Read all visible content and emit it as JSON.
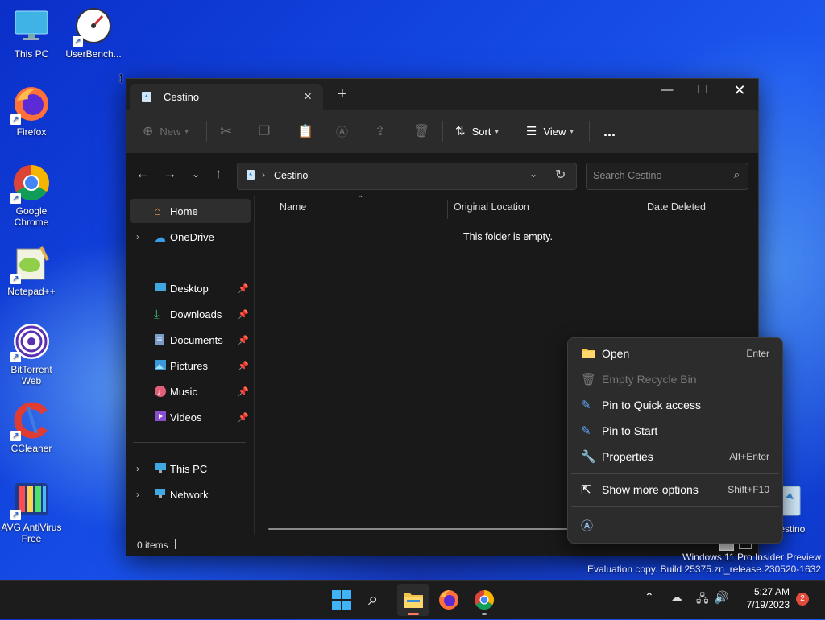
{
  "desktop": {
    "icons": [
      {
        "label": "This PC"
      },
      {
        "label": "UserBench..."
      },
      {
        "label": "Firefox"
      },
      {
        "label": "Google Chrome"
      },
      {
        "label": "Notepad++"
      },
      {
        "label": "BitTorrent Web"
      },
      {
        "label": "CCleaner"
      },
      {
        "label": "AVG AntiVirus Free"
      },
      {
        "label": "Cestino"
      }
    ]
  },
  "explorer": {
    "tab_title": "Cestino",
    "toolbar": {
      "new_label": "New",
      "sort_label": "Sort",
      "view_label": "View",
      "more_label": "..."
    },
    "address": {
      "path": "Cestino",
      "search_placeholder": "Search Cestino"
    },
    "sidebar": {
      "items": [
        {
          "label": "Home"
        },
        {
          "label": "OneDrive"
        },
        {
          "label": "Desktop"
        },
        {
          "label": "Downloads"
        },
        {
          "label": "Documents"
        },
        {
          "label": "Pictures"
        },
        {
          "label": "Music"
        },
        {
          "label": "Videos"
        },
        {
          "label": "This PC"
        },
        {
          "label": "Network"
        }
      ]
    },
    "columns": [
      "Name",
      "Original Location",
      "Date Deleted"
    ],
    "empty_message": "This folder is empty.",
    "status": "0 items"
  },
  "context_menu": {
    "items": [
      {
        "label": "Open",
        "shortcut": "Enter",
        "icon": "folder-open-icon"
      },
      {
        "label": "Empty Recycle Bin",
        "shortcut": "",
        "icon": "trash-icon",
        "disabled": true
      },
      {
        "label": "Pin to Quick access",
        "shortcut": "",
        "icon": "pin-icon"
      },
      {
        "label": "Pin to Start",
        "shortcut": "",
        "icon": "pin-icon"
      },
      {
        "label": "Properties",
        "shortcut": "Alt+Enter",
        "icon": "wrench-icon"
      },
      {
        "label": "Show more options",
        "shortcut": "Shift+F10",
        "icon": "share-icon"
      }
    ]
  },
  "watermark": {
    "line1": "Windows 11 Pro Insider Preview",
    "line2": "Evaluation copy. Build 25375.zn_release.230520-1632"
  },
  "taskbar": {
    "time": "5:27 AM",
    "date": "7/19/2023",
    "notification_count": "2"
  },
  "colors": {
    "accent": "#60cdff",
    "window_bg": "#191919",
    "toolbar_bg": "#2b2b2b",
    "menu_bg": "#2c2c2c"
  }
}
